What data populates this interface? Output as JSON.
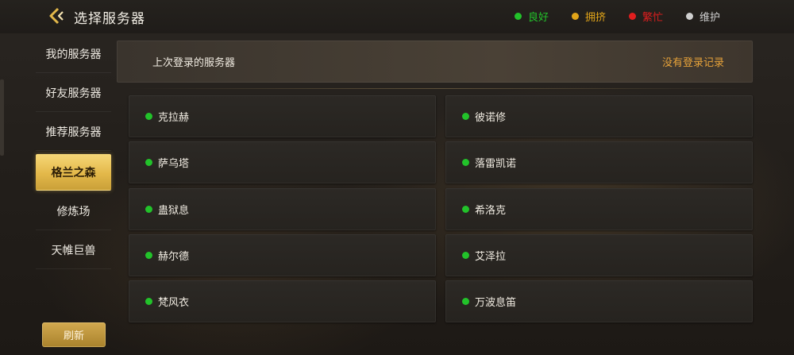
{
  "header": {
    "title": "选择服务器",
    "legend": [
      {
        "label": "良好",
        "color": "#22c22a"
      },
      {
        "label": "拥挤",
        "color": "#e2a519"
      },
      {
        "label": "繁忙",
        "color": "#e01e1e"
      },
      {
        "label": "维护",
        "color": "#cfcfcf"
      }
    ]
  },
  "sidebar": {
    "items": [
      {
        "label": "我的服务器"
      },
      {
        "label": "好友服务器"
      },
      {
        "label": "推荐服务器"
      },
      {
        "label": "格兰之森",
        "selected": true
      },
      {
        "label": "修炼场"
      },
      {
        "label": "天帷巨兽"
      }
    ],
    "refresh_label": "刷新"
  },
  "last_login": {
    "label": "上次登录的服务器",
    "value": "没有登录记录"
  },
  "servers": [
    {
      "name": "克拉赫",
      "status": "良好"
    },
    {
      "name": "彼诺修",
      "status": "良好"
    },
    {
      "name": "萨乌塔",
      "status": "良好"
    },
    {
      "name": "落雷凯诺",
      "status": "良好"
    },
    {
      "name": "蛊狱息",
      "status": "良好"
    },
    {
      "name": "希洛克",
      "status": "良好"
    },
    {
      "name": "赫尔德",
      "status": "良好"
    },
    {
      "name": "艾泽拉",
      "status": "良好"
    },
    {
      "name": "梵风衣",
      "status": "良好"
    },
    {
      "name": "万波息笛",
      "status": "良好"
    }
  ],
  "colors": {
    "accent_gold": "#e3b84a",
    "status_good": "#22c22a",
    "last_record": "#e6a23a"
  }
}
